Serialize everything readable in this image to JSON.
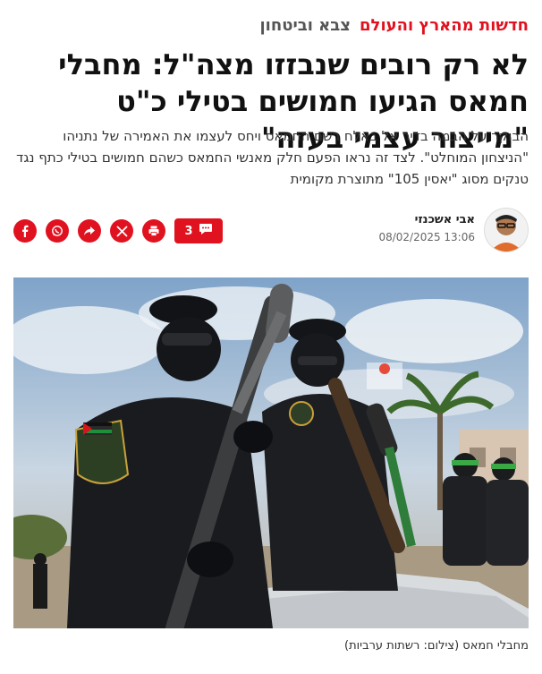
{
  "breadcrumb": {
    "section": "חדשות מהארץ והעולם",
    "subsection": "צבא וביטחון"
  },
  "headline": "לא רק רובים שנבזזו מצה\"ל: מחבלי חמאס הגיעו חמושים בטילי כ\"ט \"מייצור עצמי בעזה\"",
  "subtitle": "הבוקר על הבמה בדיר אל באלח רשם החמאס ויחס לעצמו את האמירה של נתניהו \"הניצחון המוחלט\". לצד זה נראו הפעם חלק מאנשי החמאס כשהם חמושים בטילי כתף נגד טנקים מסוג \"יאסין 105\" מתוצרת מקומית",
  "author": {
    "name": "אבי אשכנזי",
    "date": "08/02/2025 13:06"
  },
  "share": {
    "comment_count": "3",
    "icons": [
      "facebook-icon",
      "whatsapp-icon",
      "share-icon",
      "x-icon",
      "print-icon"
    ]
  },
  "caption": "מחבלי חמאס (צילום: רשתות ערביות)",
  "colors": {
    "accent": "#e1121f",
    "text": "#111111",
    "muted": "#666666"
  }
}
